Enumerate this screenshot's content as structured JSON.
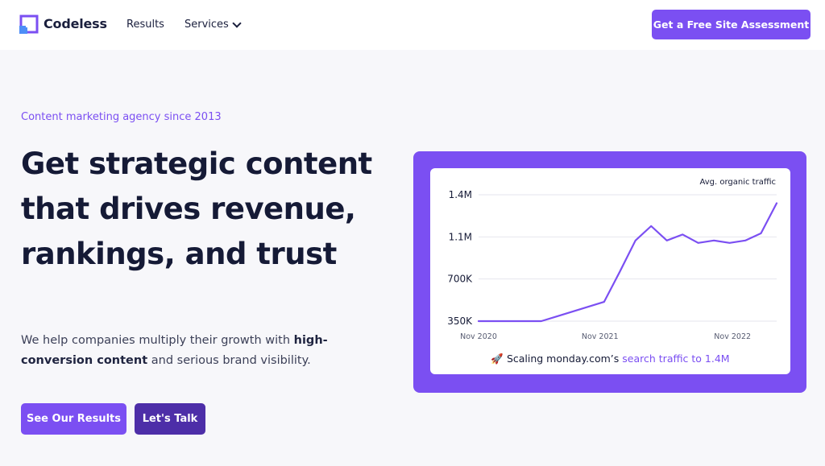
{
  "header": {
    "brand": "Codeless",
    "nav": {
      "results": "Results",
      "services": "Services"
    },
    "cta": "Get a Free Site Assessment"
  },
  "hero": {
    "eyebrow": "Content marketing agency since 2013",
    "headline": "Get strategic content that drives revenue, rankings, and trust",
    "subtext_pre": "We help companies multiply their growth with ",
    "subtext_bold": "high-conversion content",
    "subtext_post": " and serious brand visibility.",
    "buttons": {
      "results": "See Our Results",
      "talk": "Let's Talk"
    }
  },
  "colors": {
    "accent": "#7b4ff2",
    "accent_dark": "#4d2ea8",
    "text": "#151a36"
  },
  "chart_caption": {
    "icon": "rocket-icon",
    "emoji": "🚀",
    "pre": "Scaling monday.com’s ",
    "highlight": "search traffic to 1.4M"
  },
  "chart_data": {
    "type": "line",
    "title": "Avg. organic traffic",
    "xlabel": "",
    "ylabel": "",
    "ytick_labels": [
      "1.4M",
      "1.1M",
      "700K",
      "350K"
    ],
    "yticks": [
      1400000,
      1050000,
      700000,
      350000
    ],
    "xtick_labels": [
      "Nov 2020",
      "Nov 2021",
      "Nov 2022"
    ],
    "ylim": [
      350000,
      1400000
    ],
    "grid": true,
    "series": [
      {
        "color": "#7b4ff2",
        "x": [
          0,
          1,
          2,
          3,
          4,
          5,
          6,
          7,
          8,
          9,
          10,
          11,
          12,
          13,
          14,
          15,
          16,
          17,
          18,
          19,
          20,
          21,
          22,
          23,
          24,
          25,
          26,
          27
        ],
        "values": [
          350000,
          350000,
          350000,
          350000,
          350000,
          390000,
          430000,
          470000,
          510000,
          760000,
          1020000,
          1140000,
          1020000,
          1070000,
          1000000,
          1020000,
          1000000,
          1020000,
          1080000,
          1330000,
          null,
          null,
          null,
          null,
          null,
          null,
          null,
          null
        ]
      }
    ],
    "xtick_positions": [
      0,
      11,
      23
    ]
  }
}
